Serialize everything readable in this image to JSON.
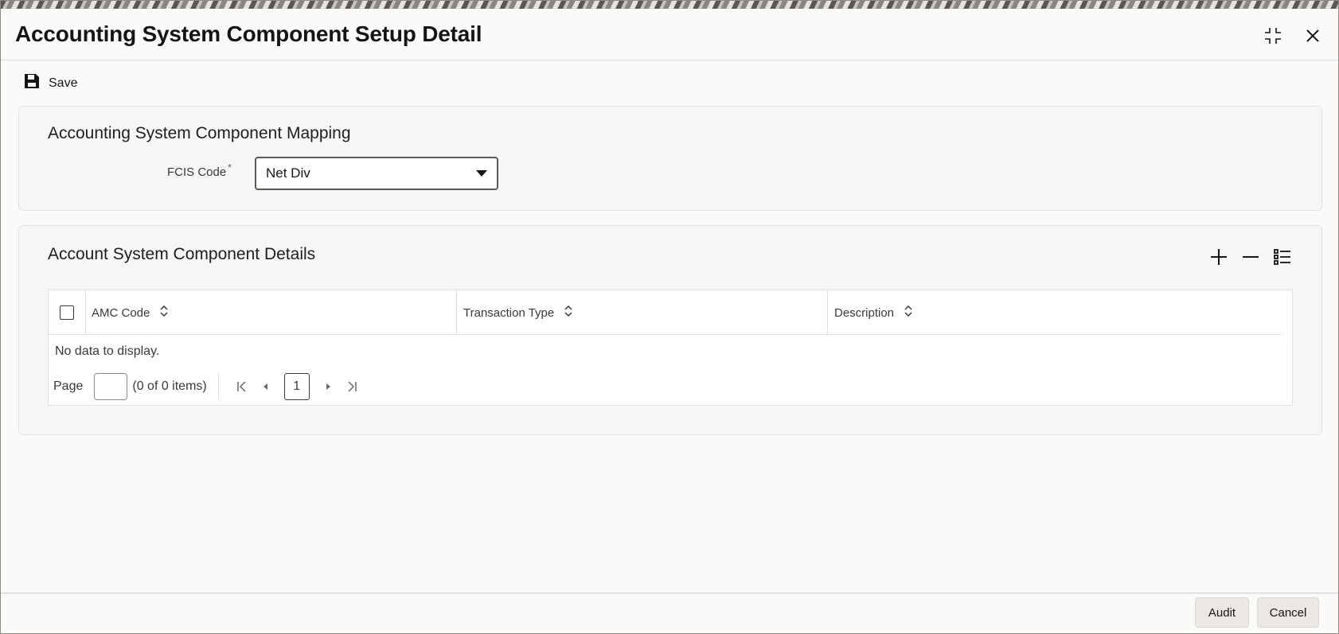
{
  "window": {
    "title": "Accounting System Component Setup Detail"
  },
  "toolbar": {
    "save_label": "Save"
  },
  "mapping": {
    "title": "Accounting System Component Mapping",
    "fcis_label": "FCIS Code",
    "required_mark": "*",
    "fcis_value": "Net Div"
  },
  "details": {
    "title": "Account System Component Details",
    "columns": [
      "AMC Code",
      "Transaction Type",
      "Description"
    ],
    "empty_text": "No data to display.",
    "pager": {
      "page_label": "Page",
      "items_text": "(0 of 0 items)",
      "current_page": "1"
    }
  },
  "footer": {
    "audit_label": "Audit",
    "cancel_label": "Cancel"
  }
}
